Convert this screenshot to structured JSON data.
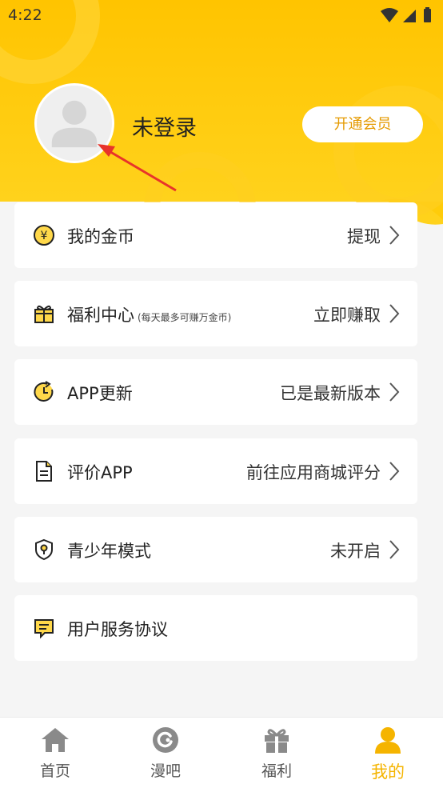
{
  "status_bar": {
    "time": "4:22"
  },
  "profile": {
    "username": "未登录",
    "vip_button": "开通会员"
  },
  "menu": [
    {
      "title": "我的金币",
      "note": "",
      "right": "提现",
      "icon": "coin-icon"
    },
    {
      "title": "福利中心",
      "note": "(每天最多可赚万金币)",
      "right": "立即赚取",
      "icon": "gift-icon"
    },
    {
      "title": "APP更新",
      "note": "",
      "right": "已是最新版本",
      "icon": "update-icon"
    },
    {
      "title": "评价APP",
      "note": "",
      "right": "前往应用商城评分",
      "icon": "document-icon"
    },
    {
      "title": "青少年模式",
      "note": "",
      "right": "未开启",
      "icon": "shield-icon"
    },
    {
      "title": "用户服务协议",
      "note": "",
      "right": "",
      "icon": "message-icon"
    }
  ],
  "tabs": [
    {
      "label": "首页",
      "icon": "home-icon"
    },
    {
      "label": "漫吧",
      "icon": "manba-icon"
    },
    {
      "label": "福利",
      "icon": "gift-icon"
    },
    {
      "label": "我的",
      "icon": "user-icon"
    }
  ],
  "colors": {
    "accent": "#FFC400",
    "accent_text": "#E59A00",
    "tab_active": "#F5B400"
  }
}
